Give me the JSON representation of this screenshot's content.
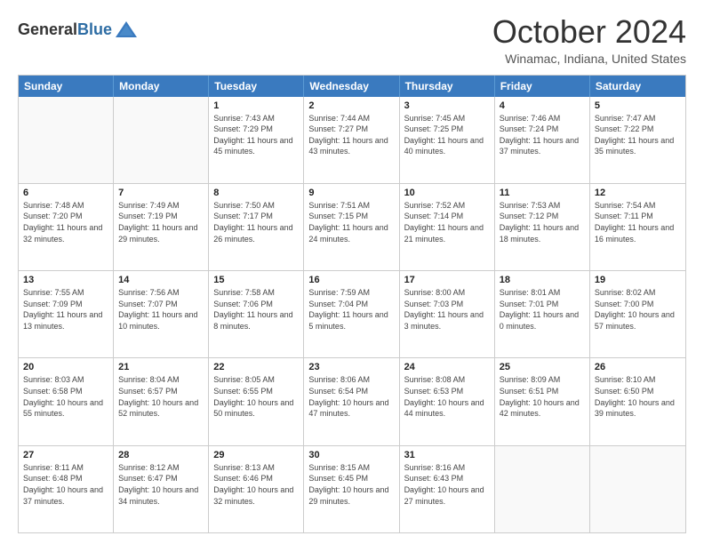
{
  "logo": {
    "line1": "General",
    "line2": "Blue"
  },
  "title": "October 2024",
  "location": "Winamac, Indiana, United States",
  "weekdays": [
    "Sunday",
    "Monday",
    "Tuesday",
    "Wednesday",
    "Thursday",
    "Friday",
    "Saturday"
  ],
  "weeks": [
    [
      {
        "day": "",
        "info": ""
      },
      {
        "day": "",
        "info": ""
      },
      {
        "day": "1",
        "info": "Sunrise: 7:43 AM\nSunset: 7:29 PM\nDaylight: 11 hours and 45 minutes."
      },
      {
        "day": "2",
        "info": "Sunrise: 7:44 AM\nSunset: 7:27 PM\nDaylight: 11 hours and 43 minutes."
      },
      {
        "day": "3",
        "info": "Sunrise: 7:45 AM\nSunset: 7:25 PM\nDaylight: 11 hours and 40 minutes."
      },
      {
        "day": "4",
        "info": "Sunrise: 7:46 AM\nSunset: 7:24 PM\nDaylight: 11 hours and 37 minutes."
      },
      {
        "day": "5",
        "info": "Sunrise: 7:47 AM\nSunset: 7:22 PM\nDaylight: 11 hours and 35 minutes."
      }
    ],
    [
      {
        "day": "6",
        "info": "Sunrise: 7:48 AM\nSunset: 7:20 PM\nDaylight: 11 hours and 32 minutes."
      },
      {
        "day": "7",
        "info": "Sunrise: 7:49 AM\nSunset: 7:19 PM\nDaylight: 11 hours and 29 minutes."
      },
      {
        "day": "8",
        "info": "Sunrise: 7:50 AM\nSunset: 7:17 PM\nDaylight: 11 hours and 26 minutes."
      },
      {
        "day": "9",
        "info": "Sunrise: 7:51 AM\nSunset: 7:15 PM\nDaylight: 11 hours and 24 minutes."
      },
      {
        "day": "10",
        "info": "Sunrise: 7:52 AM\nSunset: 7:14 PM\nDaylight: 11 hours and 21 minutes."
      },
      {
        "day": "11",
        "info": "Sunrise: 7:53 AM\nSunset: 7:12 PM\nDaylight: 11 hours and 18 minutes."
      },
      {
        "day": "12",
        "info": "Sunrise: 7:54 AM\nSunset: 7:11 PM\nDaylight: 11 hours and 16 minutes."
      }
    ],
    [
      {
        "day": "13",
        "info": "Sunrise: 7:55 AM\nSunset: 7:09 PM\nDaylight: 11 hours and 13 minutes."
      },
      {
        "day": "14",
        "info": "Sunrise: 7:56 AM\nSunset: 7:07 PM\nDaylight: 11 hours and 10 minutes."
      },
      {
        "day": "15",
        "info": "Sunrise: 7:58 AM\nSunset: 7:06 PM\nDaylight: 11 hours and 8 minutes."
      },
      {
        "day": "16",
        "info": "Sunrise: 7:59 AM\nSunset: 7:04 PM\nDaylight: 11 hours and 5 minutes."
      },
      {
        "day": "17",
        "info": "Sunrise: 8:00 AM\nSunset: 7:03 PM\nDaylight: 11 hours and 3 minutes."
      },
      {
        "day": "18",
        "info": "Sunrise: 8:01 AM\nSunset: 7:01 PM\nDaylight: 11 hours and 0 minutes."
      },
      {
        "day": "19",
        "info": "Sunrise: 8:02 AM\nSunset: 7:00 PM\nDaylight: 10 hours and 57 minutes."
      }
    ],
    [
      {
        "day": "20",
        "info": "Sunrise: 8:03 AM\nSunset: 6:58 PM\nDaylight: 10 hours and 55 minutes."
      },
      {
        "day": "21",
        "info": "Sunrise: 8:04 AM\nSunset: 6:57 PM\nDaylight: 10 hours and 52 minutes."
      },
      {
        "day": "22",
        "info": "Sunrise: 8:05 AM\nSunset: 6:55 PM\nDaylight: 10 hours and 50 minutes."
      },
      {
        "day": "23",
        "info": "Sunrise: 8:06 AM\nSunset: 6:54 PM\nDaylight: 10 hours and 47 minutes."
      },
      {
        "day": "24",
        "info": "Sunrise: 8:08 AM\nSunset: 6:53 PM\nDaylight: 10 hours and 44 minutes."
      },
      {
        "day": "25",
        "info": "Sunrise: 8:09 AM\nSunset: 6:51 PM\nDaylight: 10 hours and 42 minutes."
      },
      {
        "day": "26",
        "info": "Sunrise: 8:10 AM\nSunset: 6:50 PM\nDaylight: 10 hours and 39 minutes."
      }
    ],
    [
      {
        "day": "27",
        "info": "Sunrise: 8:11 AM\nSunset: 6:48 PM\nDaylight: 10 hours and 37 minutes."
      },
      {
        "day": "28",
        "info": "Sunrise: 8:12 AM\nSunset: 6:47 PM\nDaylight: 10 hours and 34 minutes."
      },
      {
        "day": "29",
        "info": "Sunrise: 8:13 AM\nSunset: 6:46 PM\nDaylight: 10 hours and 32 minutes."
      },
      {
        "day": "30",
        "info": "Sunrise: 8:15 AM\nSunset: 6:45 PM\nDaylight: 10 hours and 29 minutes."
      },
      {
        "day": "31",
        "info": "Sunrise: 8:16 AM\nSunset: 6:43 PM\nDaylight: 10 hours and 27 minutes."
      },
      {
        "day": "",
        "info": ""
      },
      {
        "day": "",
        "info": ""
      }
    ]
  ]
}
